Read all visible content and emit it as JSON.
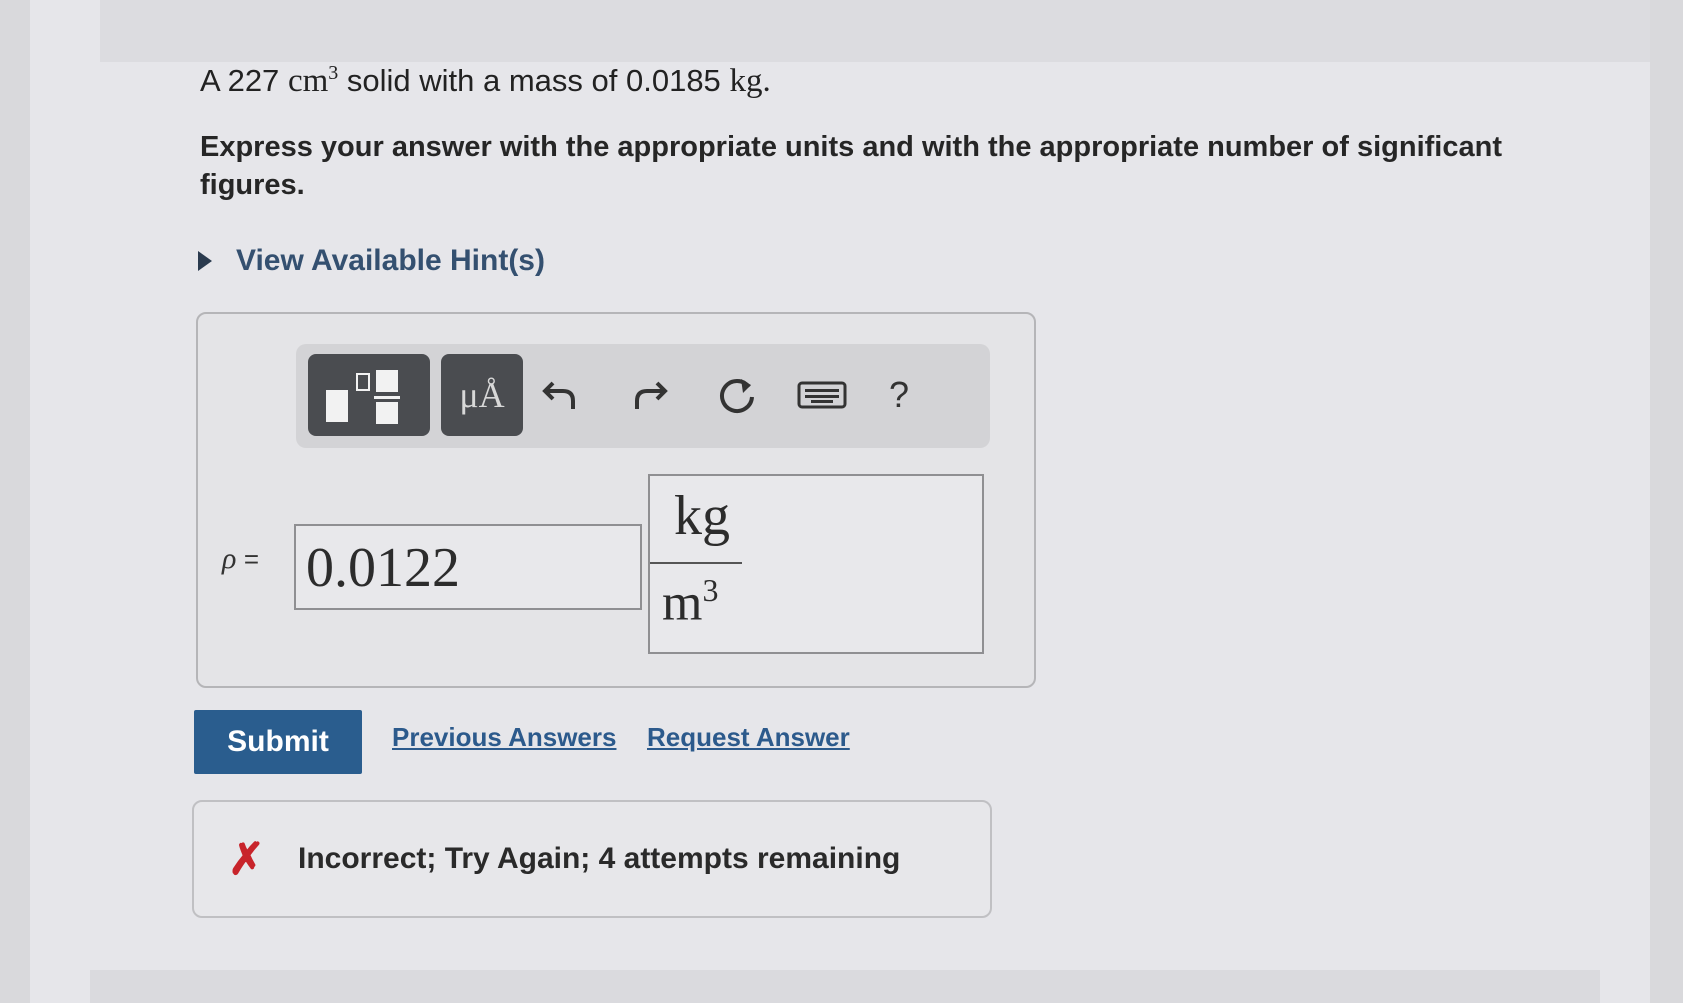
{
  "problem": {
    "prefix": "A 227",
    "volume_unit": "cm",
    "volume_exp": "3",
    "middle": " solid with a mass of 0.0185",
    "mass_unit": "kg",
    "suffix": "."
  },
  "instruction": "Express your answer with the appropriate units and with the appropriate number of significant figures.",
  "hint": {
    "label": "View Available Hint(s)"
  },
  "toolbar": {
    "units_label": "μÅ",
    "help_label": "?"
  },
  "answer": {
    "variable": "ρ",
    "equals": "=",
    "value": "0.0122",
    "unit_numerator": "kg",
    "unit_denominator": "m",
    "unit_denominator_exp": "3"
  },
  "actions": {
    "submit": "Submit",
    "previous": "Previous Answers",
    "request": "Request Answer"
  },
  "feedback": {
    "icon": "✗",
    "message": "Incorrect; Try Again; 4 attempts remaining"
  },
  "colors": {
    "submit_bg": "#2a5d8e",
    "link": "#2c5a8c",
    "error": "#c8242b"
  }
}
